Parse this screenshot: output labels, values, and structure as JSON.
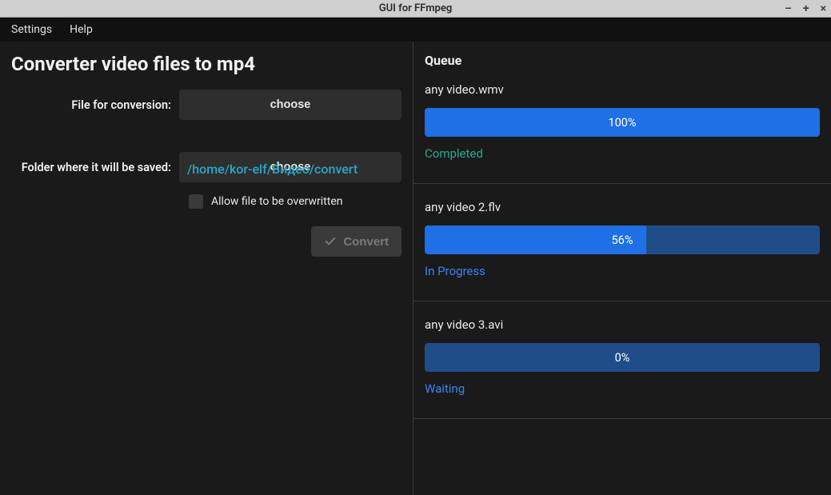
{
  "window": {
    "title": "GUI for FFmpeg"
  },
  "menubar": {
    "settings": "Settings",
    "help": "Help"
  },
  "left": {
    "title": "Converter video files to mp4",
    "file_label": "File for conversion:",
    "file_button": "choose",
    "folder_label": "Folder where it will be saved:",
    "folder_button": "choose",
    "folder_path": "/home/kor-elf/Видео/convert",
    "overwrite_label": "Allow file to be overwritten",
    "convert_button": "Convert"
  },
  "queue": {
    "title": "Queue",
    "items": [
      {
        "filename": "any video.wmv",
        "progress_pct": 100,
        "progress_text": "100%",
        "status_text": "Completed",
        "status_class": "status-completed"
      },
      {
        "filename": "any video 2.flv",
        "progress_pct": 56,
        "progress_text": "56%",
        "status_text": "In Progress",
        "status_class": "status-progress"
      },
      {
        "filename": "any video 3.avi",
        "progress_pct": 0,
        "progress_text": "0%",
        "status_text": "Waiting",
        "status_class": "status-waiting"
      }
    ]
  }
}
